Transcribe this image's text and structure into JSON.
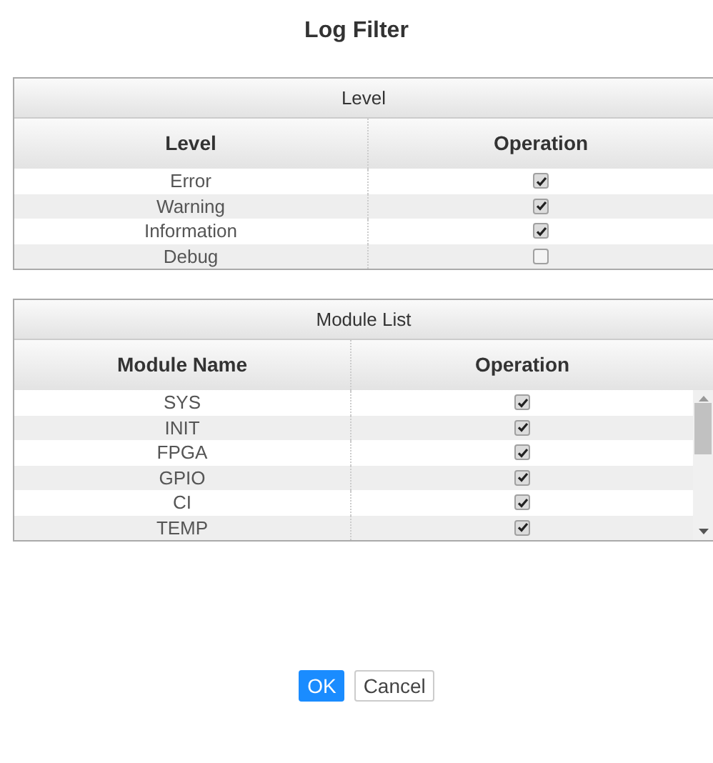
{
  "title": "Log Filter",
  "level_table": {
    "caption": "Level",
    "columns": [
      "Level",
      "Operation"
    ],
    "rows": [
      {
        "name": "Error",
        "checked": true
      },
      {
        "name": "Warning",
        "checked": true
      },
      {
        "name": "Information",
        "checked": true
      },
      {
        "name": "Debug",
        "checked": false
      }
    ]
  },
  "module_table": {
    "caption": "Module List",
    "columns": [
      "Module Name",
      "Operation"
    ],
    "rows": [
      {
        "name": "SYS",
        "checked": true
      },
      {
        "name": "INIT",
        "checked": true
      },
      {
        "name": "FPGA",
        "checked": true
      },
      {
        "name": "GPIO",
        "checked": true
      },
      {
        "name": "CI",
        "checked": true
      },
      {
        "name": "TEMP",
        "checked": true
      }
    ]
  },
  "buttons": [
    {
      "label": "OK",
      "kind": "primary"
    },
    {
      "label": "Cancel",
      "kind": "secondary"
    }
  ]
}
